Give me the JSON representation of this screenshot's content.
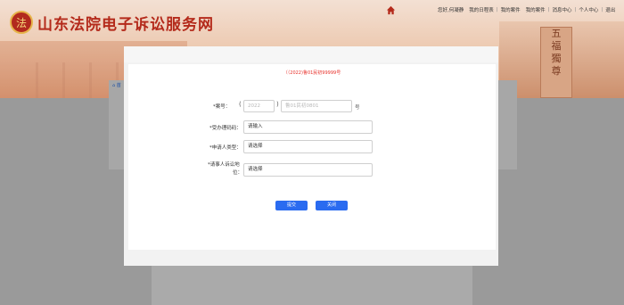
{
  "site": {
    "title": "山东法院电子诉讼服务网",
    "logo_icon": "court-emblem-icon",
    "emblem_text": "法",
    "stele_text": [
      "五",
      "福",
      "獨",
      "尊"
    ]
  },
  "topnav": {
    "home_icon": "home-icon",
    "items": [
      "您好,何凝静",
      "我的日程表",
      "我的案件",
      "我的案件",
      "消息中心",
      "个人中心",
      "退出"
    ]
  },
  "background": {
    "tab_icon": "home-icon",
    "tab_label": "首"
  },
  "modal": {
    "case_reference": "（（2022)鲁01民初99999号",
    "fields": {
      "case_number": {
        "label": "*案号：",
        "year_placeholder": "2022",
        "code_placeholder": "鲁01民初0801",
        "suffix": "号"
      },
      "identity_number": {
        "label": "*受办理码码：",
        "value": "请输入"
      },
      "applicant_type": {
        "label": "*申请人类型：",
        "value": "请选择"
      },
      "litigation_position": {
        "label_line1": "*请事人诉讼地",
        "label_line2": "位：",
        "value": "请选择"
      }
    },
    "buttons": {
      "submit": "提交",
      "close": "关闭"
    }
  },
  "colors": {
    "brand_red": "#b42a1b",
    "primary_blue": "#2a6bf0",
    "required_red": "#e8302a"
  }
}
